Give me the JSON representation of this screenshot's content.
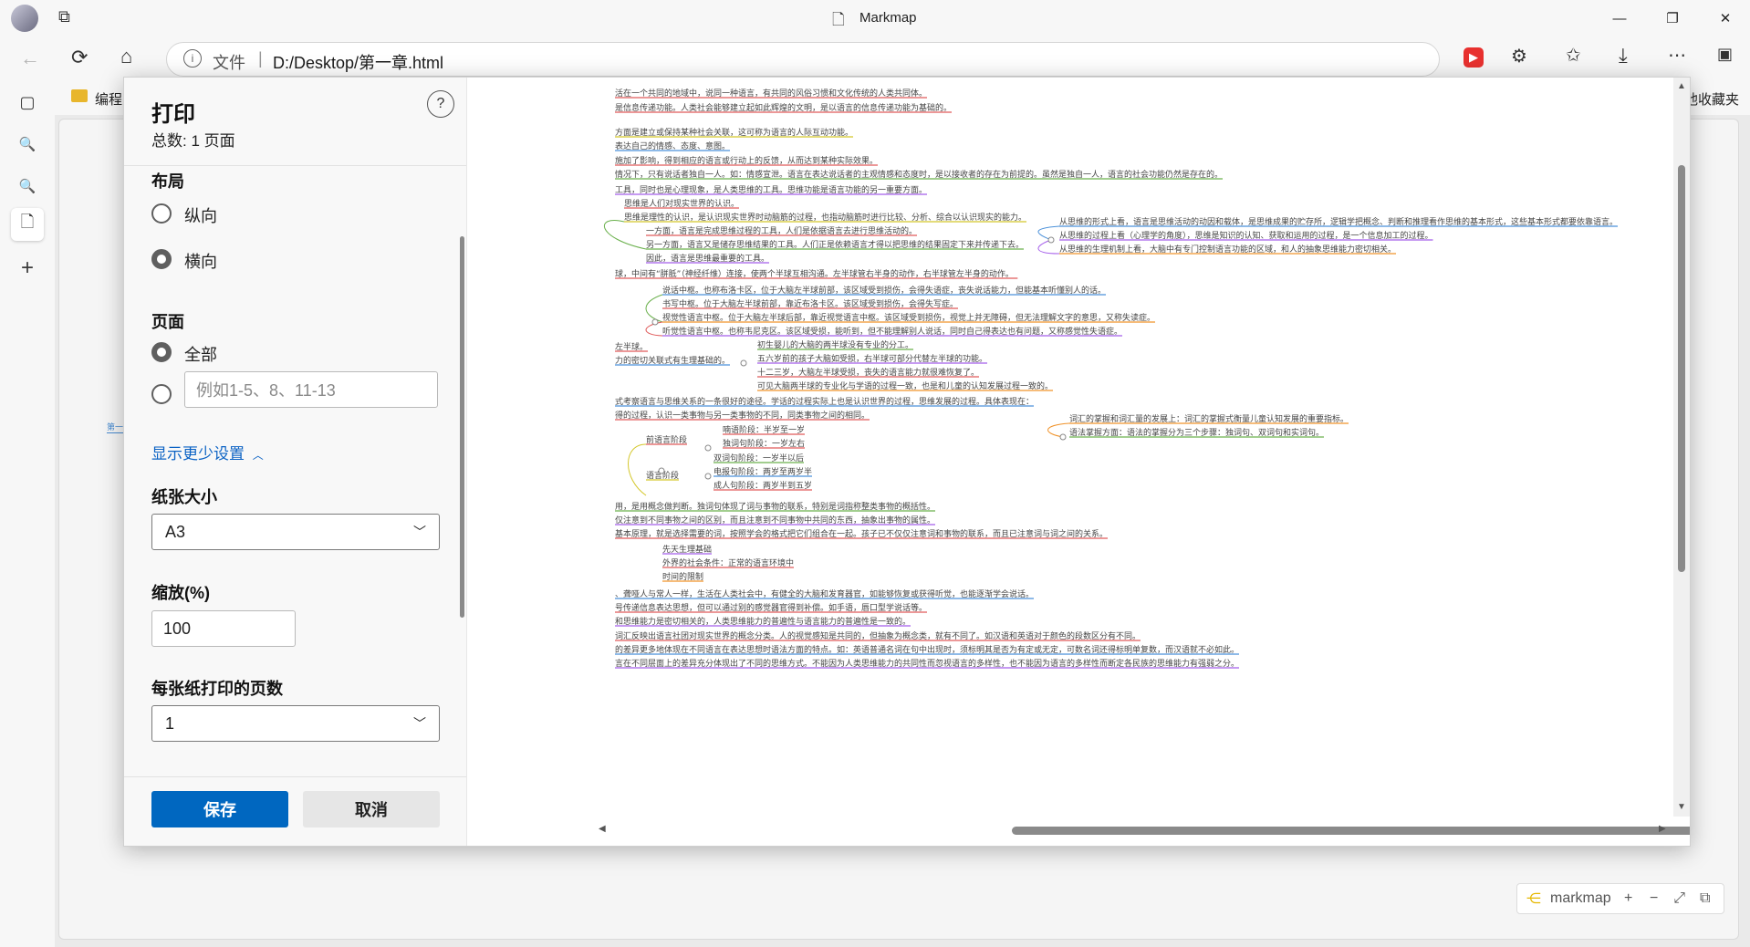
{
  "window": {
    "title": "Markmap",
    "minimize": "—",
    "maximize": "❐",
    "close": "✕"
  },
  "address": {
    "info_label": "文件",
    "separator": "|",
    "url": "D:/Desktop/第一章.html"
  },
  "favorites": {
    "folder_label": "编程",
    "other_label": "他收藏夹"
  },
  "print": {
    "title": "打印",
    "total": "总数: 1 页面",
    "help": "?",
    "layout": {
      "heading": "布局",
      "portrait": "纵向",
      "landscape": "横向",
      "selected": "landscape"
    },
    "pages": {
      "heading": "页面",
      "all": "全部",
      "custom_placeholder": "例如1-5、8、11-13",
      "selected": "all"
    },
    "show_less": "显示更少设置",
    "paper": {
      "heading": "纸张大小",
      "value": "A3"
    },
    "scale": {
      "heading": "缩放(%)",
      "value": "100"
    },
    "per_sheet": {
      "heading": "每张纸打印的页数",
      "value": "1"
    },
    "save": "保存",
    "cancel": "取消"
  },
  "preview": {
    "lines": [
      {
        "text": "活在一个共同的地域中，说同一种语言，有共同的风俗习惯和文化传统的人类共同体。",
        "color": "#e05a5a"
      },
      {
        "text": "是信息传递功能。人类社会能够建立起如此辉煌的文明，是以语言的信息传递功能为基础的。",
        "color": "#e05a5a"
      },
      {
        "text": "方面是建立或保持某种社会关联，这可称为语言的人际互动功能。",
        "color": "#d4c72a"
      },
      {
        "text": "表达自己的情感、态度、意图。",
        "color": "#4a90d9"
      },
      {
        "text": "施加了影响，得到相应的语言或行动上的反馈，从而达到某种实际效果。",
        "color": "#e05a5a"
      },
      {
        "text": "情况下，只有说话者独自一人。如：情感宣泄。语言在表达说话者的主观情感和态度时，是以接收者的存在为前提的。虽然是独自一人，语言的社会功能仍然是存在的。",
        "color": "#6ab04c"
      },
      {
        "text": "工具，同时也是心理现象，是人类思维的工具。思维功能是语言功能的另一重要方面。",
        "color": "#a55eea"
      },
      {
        "text": "思维是人们对现实世界的认识。",
        "color": "#e05a5a"
      },
      {
        "text": "思维是理性的认识，是认识现实世界时动脑筋的过程，也指动脑筋时进行比较、分析、综合以认识现实的能力。",
        "color": "#d4c72a"
      },
      {
        "text": "一方面，语言是完成思维过程的工具，人们是依据语言去进行思维活动的。",
        "color": "#e05a5a"
      },
      {
        "text": "另一方面，语言又是储存思维结果的工具。人们正是依赖语言才得以把思维的结果固定下来并传递下去。",
        "color": "#6ab04c"
      },
      {
        "text": "因此，语言是思维最重要的工具。",
        "color": "#a55eea"
      },
      {
        "text": "球，中间有“胼胝”（神经纤维）连接，使两个半球互相沟通。左半球管右半身的动作，右半球管左半身的动作。",
        "color": "#e05a5a"
      },
      {
        "text": "说话中枢。也称布洛卡区，位于大脑左半球前部，该区域受到损伤，会得失语症，丧失说话能力，但能基本听懂别人的话。",
        "color": "#4a90d9"
      },
      {
        "text": "书写中枢。位于大脑左半球前部，靠近布洛卡区。该区域受到损伤，会得失写症。",
        "color": "#e05a5a"
      },
      {
        "text": "视觉性语言中枢。位于大脑左半球后部，靠近视觉语言中枢。该区域受到损伤，视觉上并无障碍，但无法理解文字的意思，又称失读症。",
        "color": "#f0932b"
      },
      {
        "text": "听觉性语言中枢。也称韦尼克区。该区域受损，能听到，但不能理解别人说话，同时自己得表达也有问题，又称感觉性失语症。",
        "color": "#a55eea"
      },
      {
        "text": "左半球。",
        "color": "#e05a5a"
      },
      {
        "text": "初生婴儿的大脑的两半球没有专业的分工。",
        "color": "#6ab04c"
      },
      {
        "text": "力的密切关联式有生理基础的。",
        "color": "#4a90d9"
      },
      {
        "text": "五六岁前的孩子大脑如受损，右半球可部分代替左半球的功能。",
        "color": "#a55eea"
      },
      {
        "text": "十二三岁，大脑左半球受损，丧失的语言能力就很难恢复了。",
        "color": "#e05a5a"
      },
      {
        "text": "可见大脑两半球的专业化与学语的过程一致，也是和儿童的认知发展过程一致的。",
        "color": "#f0932b"
      },
      {
        "text": "式考察语言与思维关系的一条很好的途径。学话的过程实际上也是认识世界的过程，思维发展的过程。具体表现在：",
        "color": "#4a90d9"
      },
      {
        "text": "得的过程，认识一类事物与另一类事物的不同，同类事物之间的相同。",
        "color": "#e05a5a"
      },
      {
        "text": "喃语阶段：半岁至一岁",
        "color": "#e05a5a"
      },
      {
        "text": "前语言阶段",
        "color": "#e05a5a"
      },
      {
        "text": "独词句阶段：一岁左右",
        "color": "#e05a5a"
      },
      {
        "text": "双词句阶段：一岁半以后",
        "color": "#6ab04c"
      },
      {
        "text": "语言阶段",
        "color": "#d4c72a"
      },
      {
        "text": "电报句阶段：两岁至两岁半",
        "color": "#4a90d9"
      },
      {
        "text": "成人句阶段：两岁半到五岁",
        "color": "#e05a5a"
      },
      {
        "text": "用，是用概念做判断。独词句体现了词与事物的联系，特别是词指称整类事物的概括性。",
        "color": "#6ab04c"
      },
      {
        "text": "仅注意到不同事物之间的区别，而且注意到不同事物中共同的东西，抽象出事物的属性。",
        "color": "#a55eea"
      },
      {
        "text": "基本原理，就是选择需要的词，按照学会的格式把它们组合在一起。孩子已不仅仅注意词和事物的联系，而且已注意词与词之间的关系。",
        "color": "#e05a5a"
      },
      {
        "text": "先天生理基础",
        "color": "#a55eea"
      },
      {
        "text": "外界的社会条件：正常的语言环境中",
        "color": "#e05a5a"
      },
      {
        "text": "时间的限制",
        "color": "#f0932b"
      },
      {
        "text": "、聋哑人与常人一样，生活在人类社会中，有健全的大脑和发育器官，如能够恢复或获得听觉，也能逐渐学会说话。",
        "color": "#4a90d9"
      },
      {
        "text": "号传递信息表达思想，但可以通过别的感觉器官得到补偿。如手语，唇口型学说话等。",
        "color": "#e05a5a"
      },
      {
        "text": "和思维能力是密切相关的，人类思维能力的普遍性与语言能力的普遍性是一致的。",
        "color": "#a55eea"
      },
      {
        "text": "词汇反映出语言社团对现实世界的概念分类。人的视觉感知是共同的，但抽象为概念类，就有不同了。如汉语和英语对于颜色的段数区分有不同。",
        "color": "#e05a5a"
      },
      {
        "text": "的差异更多地体现在不同语言在表达思想时语法方面的特点。如：英语普通名词在句中出现时，须标明其是否为有定或无定，可数名词还得标明单复数，而汉语就不必如此。",
        "color": "#4a90d9"
      },
      {
        "text": "言在不同层面上的差异充分体现出了不同的思维方式。不能因为人类思维能力的共同性而忽视语言的多样性，也不能因为语言的多样性而断定各民族的思维能力有强弱之分。",
        "color": "#a55eea"
      },
      {
        "text": "从思维的形式上看，语言是思维活动的动因和载体，是思维成果的贮存所，逻辑学把概念、判断和推理看作思维的基本形式，这些基本形式都要依靠语言。",
        "color": "#4a90d9"
      },
      {
        "text": "从思维的过程上看（心理学的角度），思维是知识的认知、获取和运用的过程，是一个信息加工的过程。",
        "color": "#a55eea"
      },
      {
        "text": "从思维的生理机制上看，大脑中有专门控制语言功能的区域，和人的抽象思维能力密切相关。",
        "color": "#f0932b"
      },
      {
        "text": "词汇的掌握和词汇量的发展上：词汇的掌握式衡量儿童认知发展的重要指标。",
        "color": "#f0932b"
      },
      {
        "text": "语法掌握方面：语法的掌握分为三个步骤：独词句、双词句和实词句。",
        "color": "#6ab04c"
      }
    ],
    "edge_labels": [
      "第一"
    ]
  },
  "markmap_toolbar": {
    "label": "markmap",
    "zoom_in": "+",
    "zoom_out": "−",
    "fit": "⤢",
    "toggle": "⧉"
  }
}
